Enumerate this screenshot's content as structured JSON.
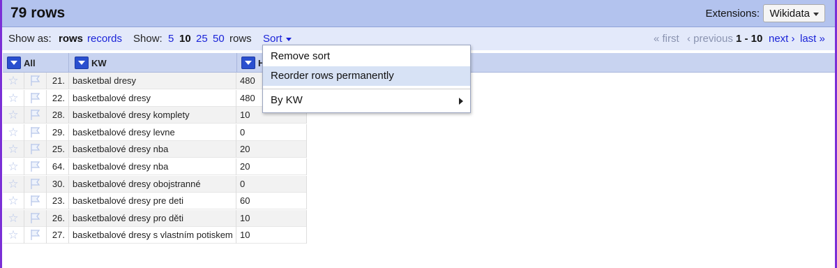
{
  "header": {
    "title": "79 rows",
    "extensions_label": "Extensions:",
    "extensions_button": "Wikidata"
  },
  "toolbar": {
    "show_as_label": "Show as:",
    "rows_label": "rows",
    "records_label": "records",
    "show_label": "Show:",
    "page_sizes": [
      "5",
      "10",
      "25",
      "50"
    ],
    "selected_page_size": "10",
    "rows_suffix": "rows",
    "sort_label": "Sort",
    "first_label": "« first",
    "previous_label": "‹ previous",
    "range": "1 - 10",
    "next_label": "next ›",
    "last_label": "last »"
  },
  "columns": {
    "all": "All",
    "kw": "KW",
    "third": "H"
  },
  "rows": [
    {
      "num": "21.",
      "kw": "basketbal dresy",
      "value": "480"
    },
    {
      "num": "22.",
      "kw": "basketbalové dresy",
      "value": "480"
    },
    {
      "num": "28.",
      "kw": "basketbalové dresy komplety",
      "value": "10"
    },
    {
      "num": "29.",
      "kw": "basketbalové dresy levne",
      "value": "0"
    },
    {
      "num": "25.",
      "kw": "basketbalové dresy nba",
      "value": "20"
    },
    {
      "num": "64.",
      "kw": "basketbalové dresy nba",
      "value": "20"
    },
    {
      "num": "30.",
      "kw": "basketbalové dresy obojstranné",
      "value": "0"
    },
    {
      "num": "23.",
      "kw": "basketbalové dresy pre deti",
      "value": "60"
    },
    {
      "num": "26.",
      "kw": "basketbalové dresy pro děti",
      "value": "10"
    },
    {
      "num": "27.",
      "kw": "basketbalové dresy s vlastním potiskem",
      "value": "10"
    }
  ],
  "sort_menu": {
    "items": [
      "Remove sort",
      "Reorder rows permanently",
      "By KW"
    ],
    "highlighted": "Reorder rows permanently"
  },
  "icons": {
    "row_star": "star-icon",
    "row_flag": "flag-icon",
    "column_menu": "dropdown-arrow-icon",
    "submenu": "chevron-right-icon"
  },
  "colors": {
    "header_bg": "#b3c3ee",
    "toolbar_bg": "#e3e9fa",
    "link": "#1a23d8",
    "column_header_bg": "#c8d3f0",
    "menu_highlight": "#d7e2f5",
    "frame": "#7b2fd6"
  }
}
